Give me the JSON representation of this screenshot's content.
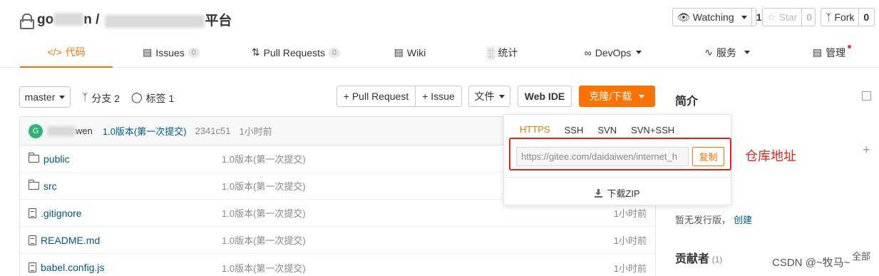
{
  "header": {
    "owner_prefix": "go",
    "owner_suffix": "n /",
    "repo_suffix": "平台",
    "watch": {
      "label": "Watching",
      "count": "1"
    },
    "star": {
      "label": "Star",
      "count": "0"
    },
    "fork": {
      "label": "Fork",
      "count": "0"
    }
  },
  "tabs": [
    {
      "label": "代码",
      "icon": "code-icon"
    },
    {
      "label": "Issues",
      "badge": "0",
      "icon": "issues-icon"
    },
    {
      "label": "Pull Requests",
      "badge": "0",
      "icon": "pull-request-icon"
    },
    {
      "label": "Wiki",
      "icon": "wiki-icon"
    },
    {
      "label": "统计",
      "icon": "stats-icon"
    },
    {
      "label": "DevOps",
      "icon": "devops-icon"
    },
    {
      "label": "服务",
      "icon": "service-icon"
    },
    {
      "label": "管理",
      "icon": "manage-icon"
    }
  ],
  "toolbar": {
    "branch": "master",
    "branches": "分支 2",
    "tags": "标签 1",
    "pull_request": "+ Pull Request",
    "issue": "+ Issue",
    "file": "文件",
    "web_ide": "Web IDE",
    "clone": "克隆/下载"
  },
  "commit": {
    "avatar": "G",
    "author_suffix": "wen",
    "message": "1.0版本(第一次提交)",
    "hash": "2341c51",
    "time": "1小时前"
  },
  "files": [
    {
      "name": "public",
      "type": "folder",
      "message": "1.0版本(第一次提交)",
      "time": ""
    },
    {
      "name": "src",
      "type": "folder",
      "message": "1.0版本(第一次提交)",
      "time": ""
    },
    {
      "name": ".gitignore",
      "type": "file",
      "message": "1.0版本(第一次提交)",
      "time": "1小时前"
    },
    {
      "name": "README.md",
      "type": "file",
      "message": "1.0版本(第一次提交)",
      "time": "1小时前"
    },
    {
      "name": "babel.config.js",
      "type": "file",
      "message": "1.0版本(第一次提交)",
      "time": "1小时前"
    }
  ],
  "clone_popup": {
    "tabs": [
      "HTTPS",
      "SSH",
      "SVN",
      "SVN+SSH"
    ],
    "url": "https://gitee.com/daidaiwen/internet_h",
    "copy": "复制",
    "download": "下载ZIP"
  },
  "annotation": "仓库地址",
  "sidebar": {
    "intro_title": "简介",
    "release_text": "暂无发行版，",
    "release_link": "创建",
    "contributors_title": "贡献者",
    "contributors_count": "(1)",
    "all": "全部"
  },
  "watermark": "CSDN @~牧马~"
}
